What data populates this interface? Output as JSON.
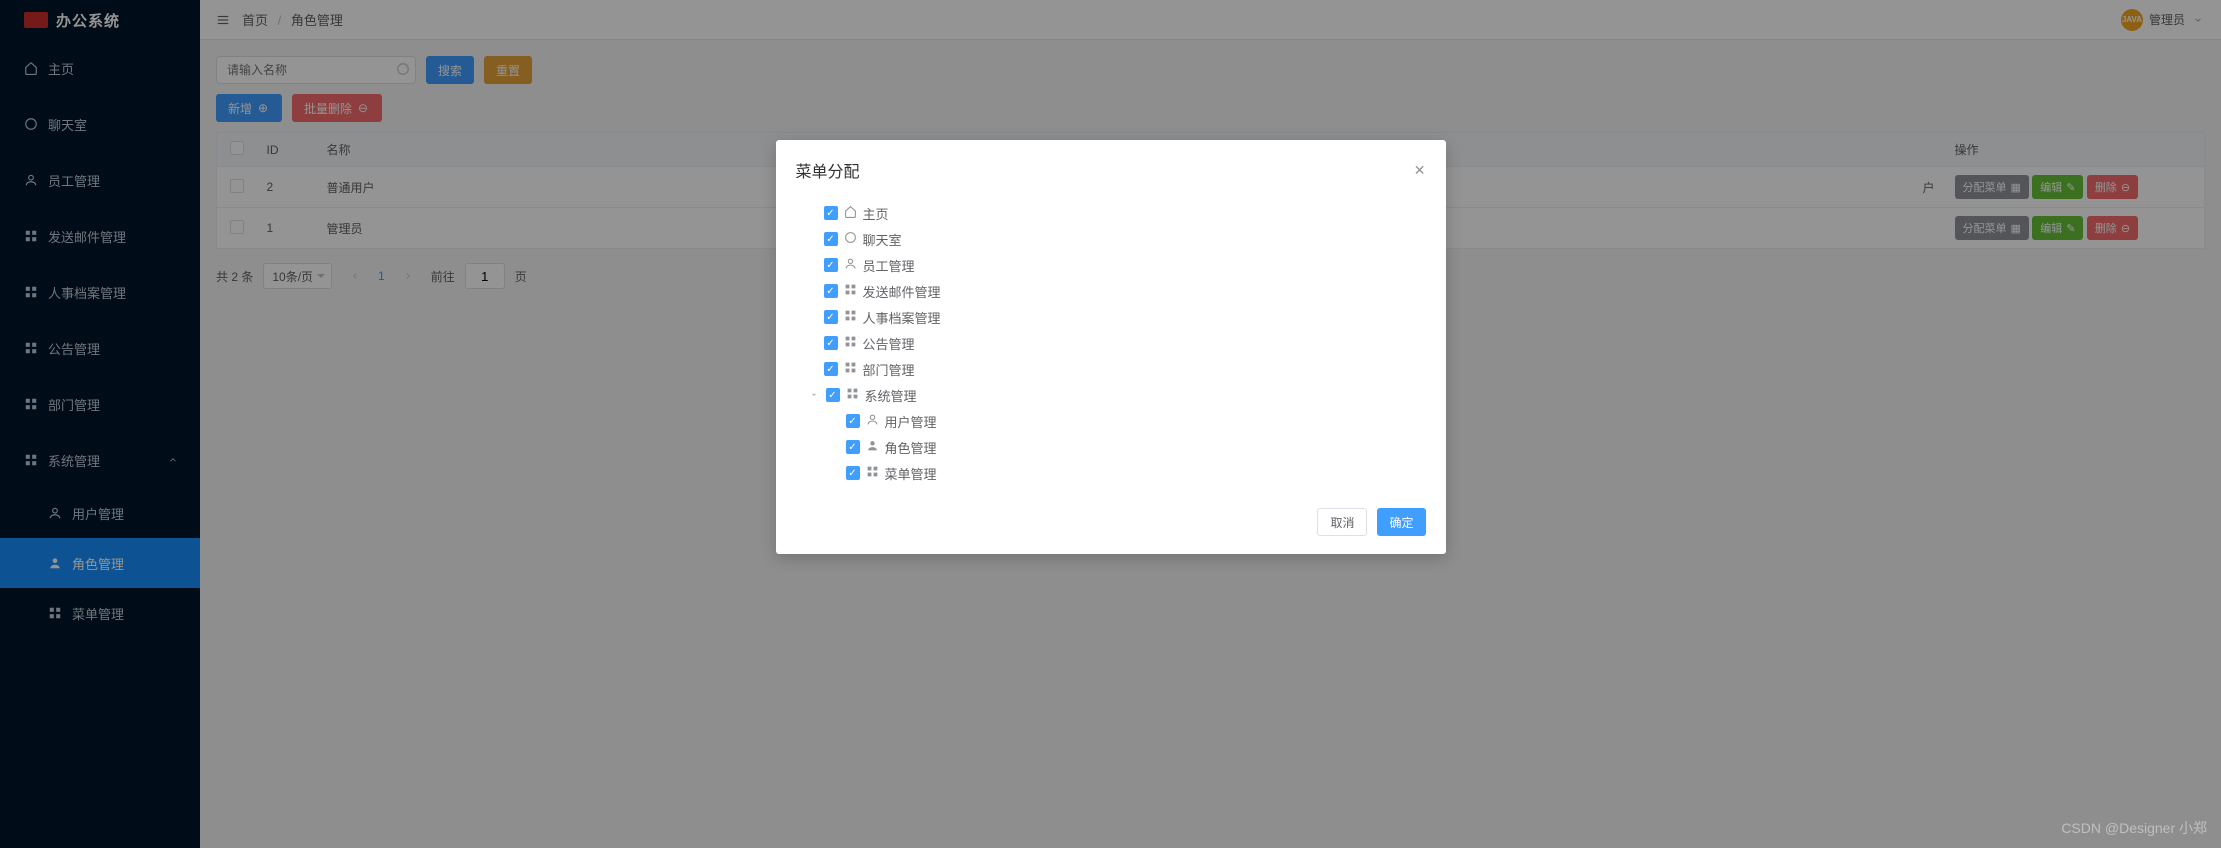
{
  "logo": {
    "mark": "办公系统",
    "text": "办公系统"
  },
  "sidebar": {
    "items": [
      {
        "icon": "home",
        "label": "主页"
      },
      {
        "icon": "chat",
        "label": "聊天室"
      },
      {
        "icon": "user",
        "label": "员工管理"
      },
      {
        "icon": "mail",
        "label": "发送邮件管理"
      },
      {
        "icon": "archive",
        "label": "人事档案管理"
      },
      {
        "icon": "notice",
        "label": "公告管理"
      },
      {
        "icon": "dept",
        "label": "部门管理"
      },
      {
        "icon": "sys",
        "label": "系统管理",
        "expandable": true
      }
    ],
    "subitems": [
      {
        "icon": "user",
        "label": "用户管理"
      },
      {
        "icon": "role",
        "label": "角色管理",
        "active": true
      },
      {
        "icon": "menu",
        "label": "菜单管理"
      }
    ]
  },
  "breadcrumb": {
    "home": "首页",
    "current": "角色管理"
  },
  "user": {
    "avatar": "JAVA",
    "name": "管理员"
  },
  "toolbar": {
    "search_placeholder": "请输入名称",
    "search": "搜索",
    "reset": "重置",
    "add": "新增",
    "batch_delete": "批量删除"
  },
  "table": {
    "headers": {
      "id": "ID",
      "name": "名称",
      "ops": "操作"
    },
    "rows": [
      {
        "id": "2",
        "name": "普通用户",
        "extra": "户"
      },
      {
        "id": "1",
        "name": "管理员",
        "extra": ""
      }
    ],
    "row_buttons": {
      "assign": "分配菜单",
      "edit": "编辑",
      "delete": "删除"
    }
  },
  "pagination": {
    "total_text": "共 2 条",
    "page_size": "10条/页",
    "current": "1",
    "goto_label": "前往",
    "goto_value": "1",
    "page_suffix": "页"
  },
  "dialog": {
    "title": "菜单分配",
    "tree": [
      {
        "level": 1,
        "icon": "home-icon",
        "label": "主页"
      },
      {
        "level": 1,
        "icon": "chat-icon",
        "label": "聊天室"
      },
      {
        "level": 1,
        "icon": "user-icon",
        "label": "员工管理"
      },
      {
        "level": 1,
        "icon": "grid-icon",
        "label": "发送邮件管理"
      },
      {
        "level": 1,
        "icon": "grid-icon",
        "label": "人事档案管理"
      },
      {
        "level": 1,
        "icon": "grid-icon",
        "label": "公告管理"
      },
      {
        "level": 1,
        "icon": "grid-icon",
        "label": "部门管理"
      },
      {
        "level": 1,
        "icon": "grid-icon",
        "label": "系统管理",
        "caret": true
      },
      {
        "level": 2,
        "icon": "user-icon",
        "label": "用户管理"
      },
      {
        "level": 2,
        "icon": "role-icon",
        "label": "角色管理"
      },
      {
        "level": 2,
        "icon": "grid-icon",
        "label": "菜单管理"
      }
    ],
    "cancel": "取消",
    "confirm": "确定"
  },
  "watermark": "CSDN @Designer 小郑"
}
